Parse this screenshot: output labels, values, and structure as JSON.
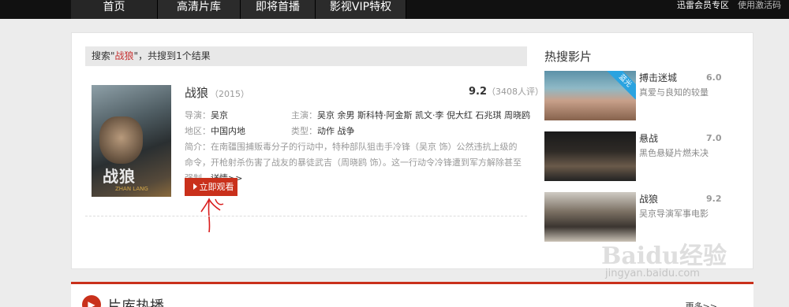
{
  "nav": {
    "items": [
      "首页",
      "高清片库",
      "即将首播",
      "影视VIP特权"
    ],
    "member": "迅雷会员专区",
    "activate": "使用激活码"
  },
  "search": {
    "prefix": "搜索\"",
    "keyword": "战狼",
    "suffix": "\"，共搜到1个结果"
  },
  "movie": {
    "title": "战狼",
    "year": "（2015）",
    "score": "9.2",
    "votes": "（3408人评）",
    "director_label": "导演：",
    "director": "吴京",
    "cast_label": "主演：",
    "cast": "吴京 余男 斯科特·阿金斯 凯文·李 倪大红 石兆琪 周晓鸥",
    "region_label": "地区：",
    "region": "中国内地",
    "genre_label": "类型：",
    "genre": "动作 战争",
    "synopsis_label": "简介：",
    "synopsis": "在南疆围捕贩毒分子的行动中，特种部队狙击手冷锋（吴京 饰）公然违抗上级的命令，开枪射杀伤害了战友的暴徒武吉（周晓鸥 饰）。这一行动令冷锋遭到军方解除甚至强制…",
    "more": "详情>>",
    "watch_label": "立即观看",
    "poster_title": "战狼",
    "poster_sub": "ZHAN LANG"
  },
  "hot": {
    "title": "热搜影片",
    "items": [
      {
        "name": "搏击迷城",
        "score": "6.0",
        "desc": "真爱与良知的较量",
        "badge": "蓝光"
      },
      {
        "name": "悬战",
        "score": "7.0",
        "desc": "黑色悬疑片燃未决"
      },
      {
        "name": "战狼",
        "score": "9.2",
        "desc": "吴京导演军事电影"
      }
    ]
  },
  "bottom": {
    "title": "片库热播",
    "more": "更多>>"
  },
  "watermark": {
    "line1": "Baidu经验",
    "line2": "jingyan.baidu.com"
  },
  "colors": {
    "accent": "#c9301b",
    "nav_bg": "#111111",
    "badge": "#2aa3e0"
  }
}
